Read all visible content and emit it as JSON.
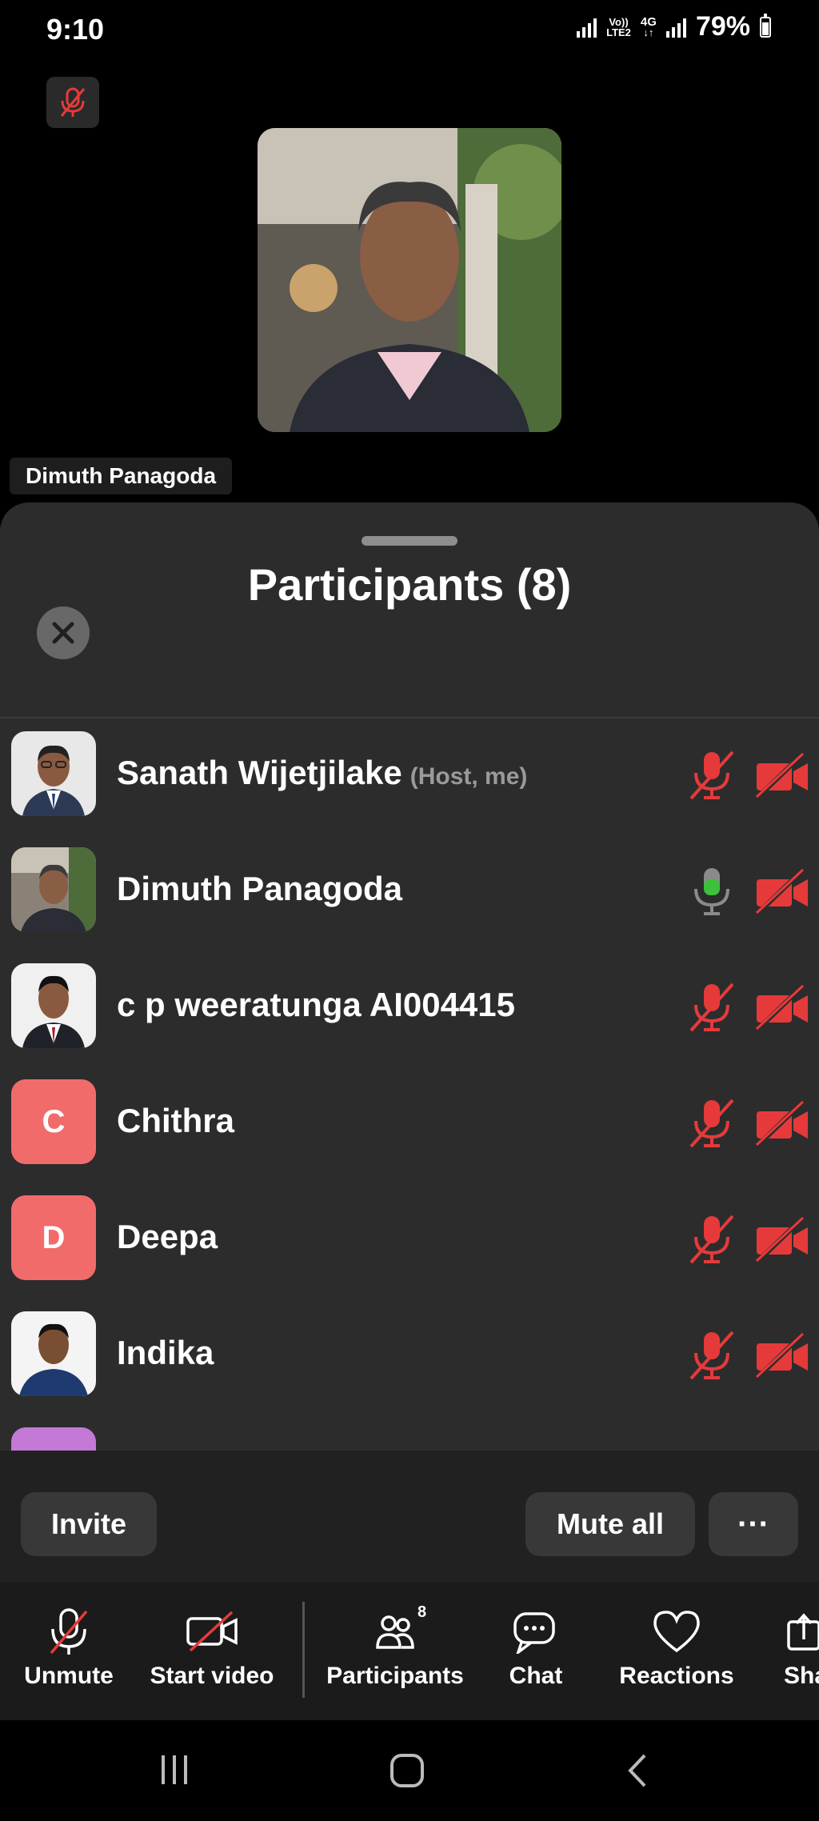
{
  "status": {
    "time": "9:10",
    "network_top": "Vo))",
    "network_bottom": "LTE2",
    "network_4g": "4G",
    "battery": "79%"
  },
  "video": {
    "speaker_name": "Dimuth Panagoda"
  },
  "participants_panel": {
    "title": "Participants (8)",
    "close_icon": "close-icon",
    "participants": [
      {
        "name": "Sanath Wijetjilake",
        "tag": "(Host, me)",
        "avatar": "photo",
        "mic": "muted",
        "video": "off"
      },
      {
        "name": "Dimuth Panagoda",
        "tag": "",
        "avatar": "photo",
        "mic": "active",
        "video": "off"
      },
      {
        "name": "c p weeratunga AI004415",
        "tag": "",
        "avatar": "photo",
        "mic": "muted",
        "video": "off"
      },
      {
        "name": "Chithra",
        "tag": "",
        "avatar": "C",
        "avatar_color": "#f26b6b",
        "mic": "muted",
        "video": "off"
      },
      {
        "name": "Deepa",
        "tag": "",
        "avatar": "D",
        "avatar_color": "#f26b6b",
        "mic": "muted",
        "video": "off"
      },
      {
        "name": "Indika",
        "tag": "",
        "avatar": "photo",
        "mic": "muted",
        "video": "off"
      }
    ],
    "invite_label": "Invite",
    "mute_all_label": "Mute all",
    "more_label": "···"
  },
  "toolbar": {
    "unmute": "Unmute",
    "start_video": "Start video",
    "participants": "Participants",
    "participants_count": "8",
    "chat": "Chat",
    "reactions": "Reactions",
    "share": "Sha"
  },
  "colors": {
    "muted_red": "#e63a3a",
    "active_green": "#3cc13b",
    "sheet_bg": "#2c2c2d",
    "avatar_letter_bg": "#f26b6b",
    "partial_avatar_bg": "#c27ad6"
  }
}
